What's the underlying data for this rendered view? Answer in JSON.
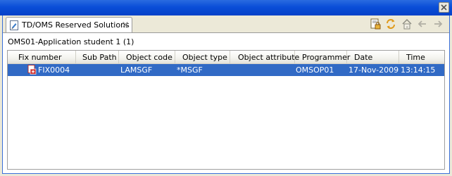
{
  "view": {
    "tab_title": "TD/OMS Reserved Solutions",
    "subtitle": "OMS01-Application student 1 (1)"
  },
  "table": {
    "columns": [
      "Fix number",
      "Sub Path",
      "Object code",
      "Object type",
      "Object attribute",
      "Programmer",
      "Date",
      "Time"
    ],
    "rows": [
      {
        "fix_number": "FIX0004",
        "sub_path": "",
        "object_code": "LAMSGF",
        "object_type": "*MSGF",
        "object_attribute": "",
        "programmer": "OMSOP01",
        "date": "17-Nov-2009",
        "time": "13:14:15",
        "selected": true
      }
    ]
  },
  "toolbar": {
    "icons": [
      "lock-report-icon",
      "refresh-icon",
      "home-icon",
      "back-arrow-icon",
      "forward-arrow-icon"
    ]
  },
  "colors": {
    "title_bar": "#0A4ED8",
    "selection": "#316AC5",
    "window_bg": "#ECE9D8"
  }
}
